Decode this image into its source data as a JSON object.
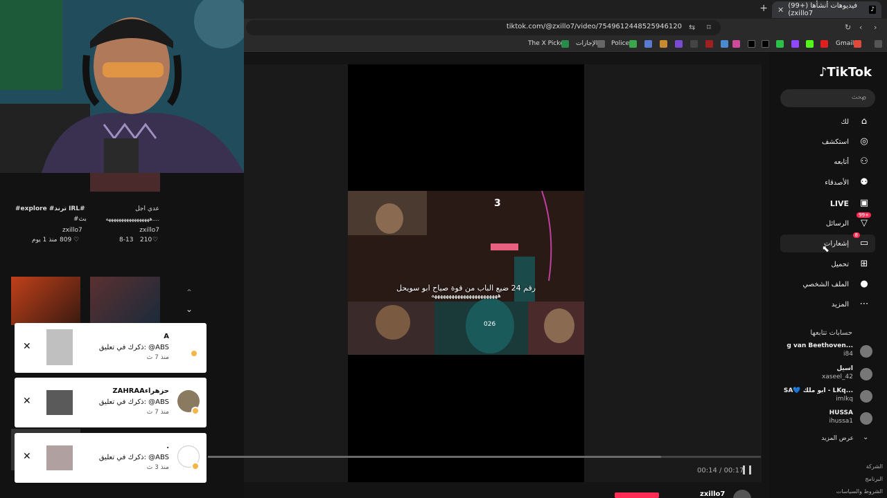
{
  "browser": {
    "tab_title": "(99+) فيديوهات أنشأها (zxillo7",
    "url": "tiktok.com/@zxillo7/video/7549612448525946120",
    "bookmarks": [
      "Gmail",
      "Police",
      "الإجازات",
      "The X Picker"
    ]
  },
  "left_panel": {
    "videos": [
      {
        "title": "عدي اجل",
        "subtitle": "هههههههههههههههههه....",
        "author": "zxillo7",
        "likes": "210",
        "date": "8-13"
      },
      {
        "title": "#explore #ترند IRL#",
        "subtitle": "#بث",
        "author": "zxillo7",
        "likes": "809",
        "date": "منذ 1 يوم"
      }
    ]
  },
  "player": {
    "caption_line1": "رقم 24 ضيع الباب من قوة صياح ابو سويحل",
    "caption_line2": "هههههههههههههههههههههههه",
    "scoreboard": "3",
    "jersey": "026",
    "current_time": "00:14",
    "duration": "00:17",
    "progress": 0.82
  },
  "nav": {
    "logo": "TikTok",
    "search_placeholder": "بحث",
    "items": [
      {
        "label": "لك",
        "icon": "home-icon"
      },
      {
        "label": "استكشف",
        "icon": "compass-icon"
      },
      {
        "label": "أتابعه",
        "icon": "user-plus-icon"
      },
      {
        "label": "الأصدقاء",
        "icon": "friends-icon"
      },
      {
        "label": "LIVE",
        "icon": "live-icon"
      },
      {
        "label": "الرسائل",
        "icon": "messages-icon",
        "badge": "99+"
      },
      {
        "label": "إشعارات",
        "icon": "notifications-icon",
        "badge": "8"
      },
      {
        "label": "تحميل",
        "icon": "upload-icon"
      },
      {
        "label": "الملف الشخصي",
        "icon": "profile-icon"
      },
      {
        "label": "المزيد",
        "icon": "more-icon"
      }
    ],
    "following_title": "حسابات تتابعها",
    "accounts": [
      {
        "name": "g van Beethoven...",
        "handle": "i84"
      },
      {
        "name": "اسيل",
        "handle": "xaseel_42"
      },
      {
        "name": "SA💙 ابو ملك - LKq...",
        "handle": "imlkq"
      },
      {
        "name": "HUSSA",
        "handle": "ihussa1"
      }
    ],
    "see_more": "عرض المزيد",
    "footer": [
      "الشركة",
      "البرنامج",
      "الشروط والسياسات"
    ]
  },
  "notifications": [
    {
      "name": "A",
      "message": "ذكرك في تعليق: @ABS",
      "time": "منذ 7 ث"
    },
    {
      "name": "ZAHRAAحزهراء",
      "message": "ذكرك في تعليق: @ABS",
      "time": "منذ 7 ث"
    },
    {
      "name": ".",
      "message": "ذكرك في تعليق: @ABS",
      "time": "منذ 3 ث"
    }
  ]
}
